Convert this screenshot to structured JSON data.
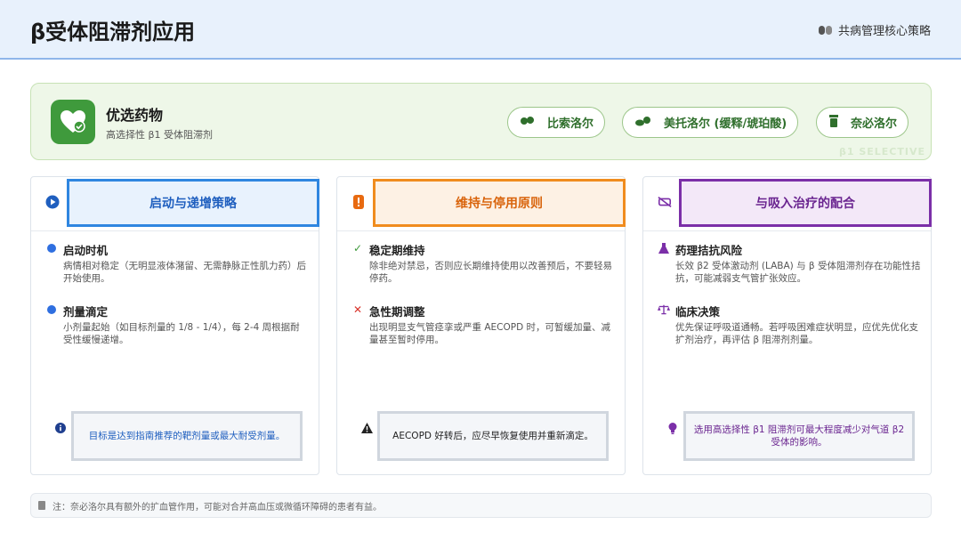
{
  "header": {
    "title": "β受体阻滞剂应用",
    "subtitle": "共病管理核心策略",
    "subtitle_icon": "pills-icon"
  },
  "preferred": {
    "title": "优选药物",
    "subtitle": "高选择性 β1 受体阻滞剂",
    "icon": "heart-check-icon",
    "watermark": "β1 SELECTIVE",
    "drugs": [
      {
        "label": "比索洛尔",
        "icon": "capsule-icon"
      },
      {
        "label": "美托洛尔 (缓释/琥珀酸)",
        "icon": "tablets-icon"
      },
      {
        "label": "奈必洛尔",
        "icon": "pill-bottle-icon"
      }
    ],
    "accent": "#3f9a3c"
  },
  "columns": [
    {
      "title": "启动与递增策略",
      "icon": "play-circle-icon",
      "accent": "#2f6fe0",
      "items": [
        {
          "title": "启动时机",
          "text": "病情相对稳定（无明显液体潴留、无需静脉正性肌力药）后开始使用。",
          "icon": "dot-icon"
        },
        {
          "title": "剂量滴定",
          "text": "小剂量起始（如目标剂量的 1/8 - 1/4），每 2-4 周根据耐受性缓慢递增。",
          "icon": "dot-icon"
        }
      ],
      "callout": "目标是达到指南推荐的靶剂量或最大耐受剂量。",
      "callout_icon": "info-icon"
    },
    {
      "title": "维持与停用原则",
      "icon": "alert-icon",
      "accent": "#f08c1e",
      "items": [
        {
          "title": "稳定期维持",
          "text": "除非绝对禁忌，否则应长期维持使用以改善预后，不要轻易停药。",
          "icon": "check-icon"
        },
        {
          "title": "急性期调整",
          "text": "出现明显支气管痉挛或严重 AECOPD 时，可暂缓加量、减量甚至暂时停用。",
          "icon": "cross-icon"
        }
      ],
      "callout": "AECOPD 好转后，应尽早恢复使用并重新滴定。",
      "callout_icon": "warning-icon"
    },
    {
      "title": "与吸入治疗的配合",
      "icon": "no-inhaler-icon",
      "accent": "#7b2fa8",
      "items": [
        {
          "title": "药理拮抗风险",
          "text": "长效 β2 受体激动剂 (LABA) 与 β 受体阻滞剂存在功能性拮抗，可能减弱支气管扩张效应。",
          "icon": "flask-icon"
        },
        {
          "title": "临床决策",
          "text": "优先保证呼吸道通畅。若呼吸困难症状明显，应优先优化支扩剂治疗，再评估 β 阻滞剂剂量。",
          "icon": "scale-icon"
        }
      ],
      "callout": "选用高选择性 β1 阻滞剂可最大程度减少对气道 β2 受体的影响。",
      "callout_icon": "lightbulb-icon"
    }
  ],
  "note": {
    "text": "注：奈必洛尔具有额外的扩血管作用，可能对合并高血压或微循环障碍的患者有益。",
    "icon": "document-icon"
  }
}
